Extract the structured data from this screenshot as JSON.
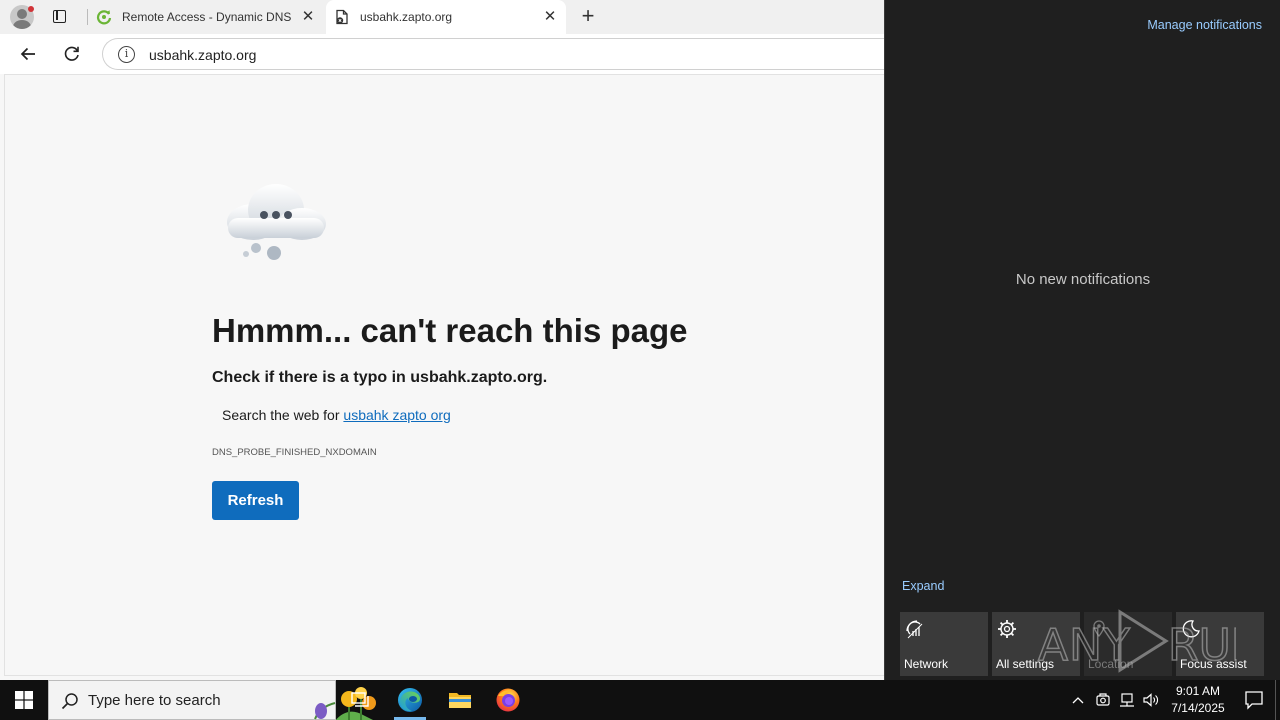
{
  "browser": {
    "tabs": [
      {
        "title": "Remote Access - Dynamic DNS - C",
        "active": false,
        "favicon": "noip-refresh-icon"
      },
      {
        "title": "usbahk.zapto.org",
        "active": true,
        "favicon": "document-error-icon"
      }
    ],
    "address_bar": {
      "url": "usbahk.zapto.org"
    }
  },
  "error_page": {
    "heading": "Hmmm... can't reach this page",
    "typo_message": "Check if there is a typo in usbahk.zapto.org.",
    "search_prefix": "Search the web for",
    "search_link": "usbahk zapto org",
    "error_code": "DNS_PROBE_FINISHED_NXDOMAIN",
    "refresh_label": "Refresh"
  },
  "action_center": {
    "manage_label": "Manage notifications",
    "empty_message": "No new notifications",
    "expand_label": "Expand",
    "quick_actions": [
      {
        "label": "Network",
        "icon": "network-icon",
        "enabled": true
      },
      {
        "label": "All settings",
        "icon": "gear-icon",
        "enabled": true
      },
      {
        "label": "Location",
        "icon": "location-icon",
        "enabled": false
      },
      {
        "label": "Focus assist",
        "icon": "moon-icon",
        "enabled": true
      }
    ],
    "watermark": "ANY RUN"
  },
  "taskbar": {
    "search_placeholder": "Type here to search",
    "time": "9:01 AM",
    "date": "7/14/2025",
    "apps": [
      "task-view-icon",
      "edge-icon",
      "file-explorer-icon",
      "firefox-icon"
    ]
  },
  "colors": {
    "accent": "#0f6cbd",
    "link_dark": "#99ccff",
    "action_center_bg": "#1f1f1f",
    "taskbar_bg": "#101010"
  }
}
